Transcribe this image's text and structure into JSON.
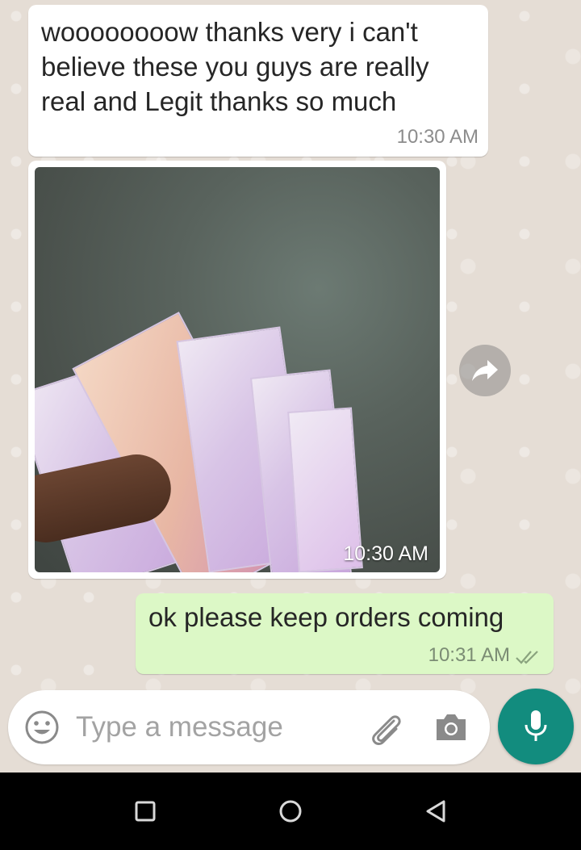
{
  "chat": {
    "messages": [
      {
        "direction": "incoming",
        "text": "woooooooow thanks very i can't believe these you guys are really real and Legit thanks so much",
        "time": "10:30 AM"
      },
      {
        "direction": "incoming",
        "type": "photo",
        "time": "10:30 AM"
      },
      {
        "direction": "outgoing",
        "text": "ok please keep orders coming",
        "time": "10:31 AM",
        "status": "read"
      }
    ]
  },
  "composer": {
    "placeholder": "Type a message",
    "icons": {
      "emoji": "emoji-icon",
      "attach": "paperclip-icon",
      "camera": "camera-icon",
      "mic": "microphone-icon"
    }
  },
  "navbar": {
    "icons": {
      "recents": "square-icon",
      "home": "circle-icon",
      "back": "back-triangle-icon"
    }
  },
  "colors": {
    "chat_background": "#e5ddd5",
    "incoming_bubble": "#ffffff",
    "outgoing_bubble": "#dcf8c6",
    "accent": "#128c7e",
    "read_ticks": "#8aa37e"
  }
}
